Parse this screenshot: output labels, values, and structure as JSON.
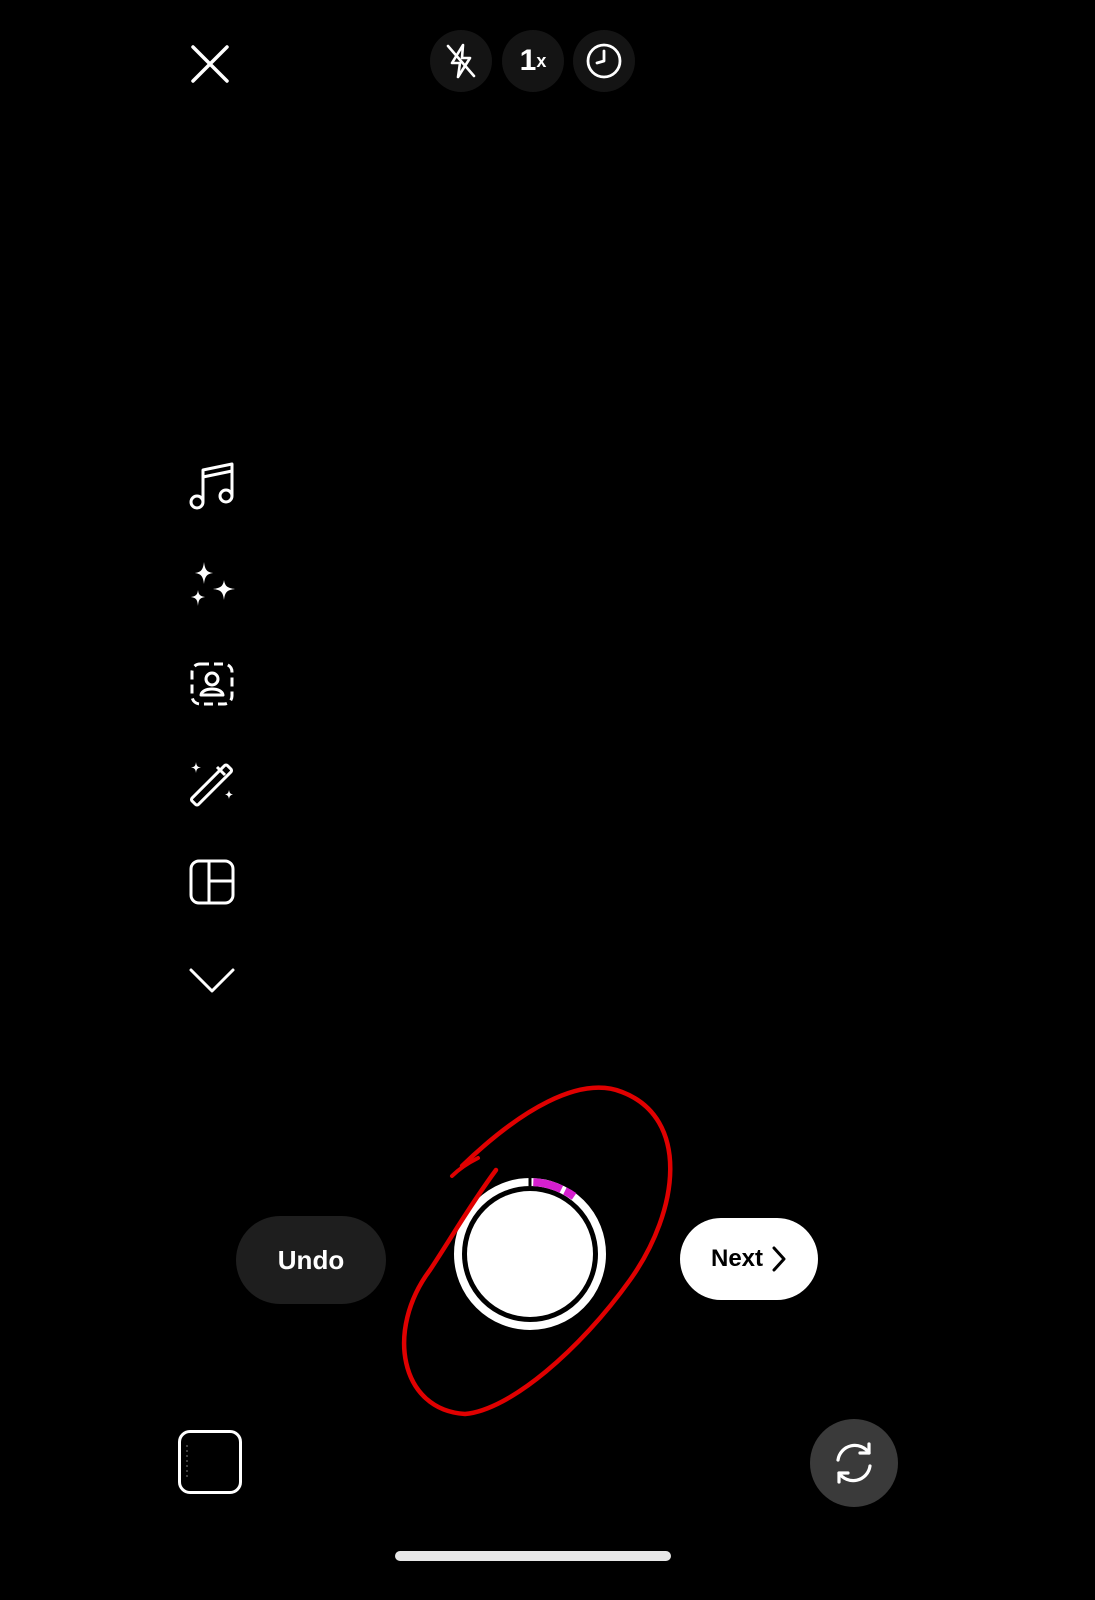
{
  "top_bar": {
    "zoom_level": "1",
    "zoom_suffix": "x"
  },
  "capture": {
    "undo_label": "Undo",
    "next_label": "Next",
    "segments_recorded": 2
  },
  "colors": {
    "background": "#000000",
    "segment_accent": "#d61fcf",
    "annotation": "#e00000"
  },
  "icons": {
    "close": "close-icon",
    "flash": "flash-off-icon",
    "timer": "timer-icon",
    "music": "music-note-icon",
    "effects": "sparkles-icon",
    "touchup": "portrait-frame-icon",
    "magic": "magic-wand-icon",
    "layout": "layout-grid-icon",
    "more": "chevron-down-icon",
    "gallery": "gallery-thumbnail-icon",
    "flip": "flip-camera-icon"
  }
}
